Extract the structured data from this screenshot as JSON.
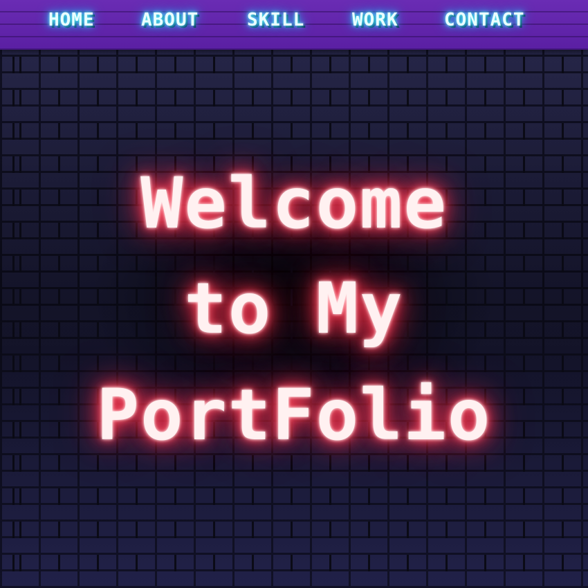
{
  "nav": {
    "items": [
      {
        "label": "HOME"
      },
      {
        "label": "ABOUT"
      },
      {
        "label": "SKILL"
      },
      {
        "label": "WORK"
      },
      {
        "label": "CONTACT"
      }
    ]
  },
  "hero": {
    "line1": "Welcome",
    "line2": "to My",
    "line3": "PortFolio"
  },
  "colors": {
    "nav_background": "#5a1fa3",
    "nav_text_glow": "#27d9ff",
    "hero_text": "#fff1f1",
    "hero_glow": "#ff3b55",
    "wall": "#1c1c36"
  }
}
